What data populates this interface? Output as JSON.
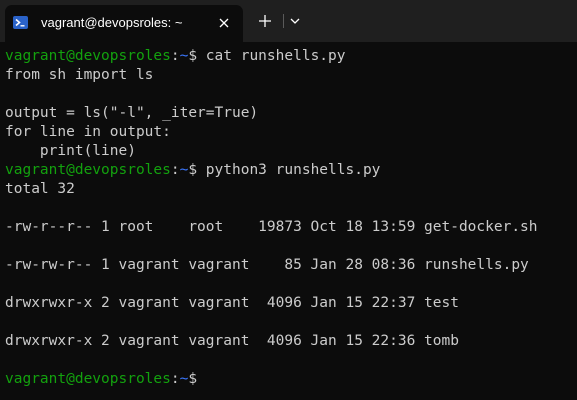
{
  "tab": {
    "title": "vagrant@devopsroles: ~",
    "icon": "terminal-icon"
  },
  "tabbar": {
    "new_tab_icon": "plus-icon",
    "dropdown_icon": "chevron-down-icon",
    "close_icon": "close-icon"
  },
  "colors": {
    "prompt_user": "#13a10e",
    "prompt_path": "#3b78ff",
    "text": "#cccccc",
    "background": "#0c0c0c",
    "tabbar": "#1f1f1f"
  },
  "prompt": {
    "user_host": "vagrant@devopsroles",
    "colon": ":",
    "path": "~",
    "symbol": "$"
  },
  "terminal": {
    "cmd1": " cat runshells.py",
    "file_lines": [
      "from sh import ls",
      "",
      "output = ls(\"-l\", _iter=True)",
      "for line in output:",
      "    print(line)"
    ],
    "cmd2": " python3 runshells.py",
    "output_lines": [
      "total 32",
      "",
      "-rw-r--r-- 1 root    root    19873 Oct 18 13:59 get-docker.sh",
      "",
      "-rw-rw-r-- 1 vagrant vagrant    85 Jan 28 08:36 runshells.py",
      "",
      "drwxrwxr-x 2 vagrant vagrant  4096 Jan 15 22:37 test",
      "",
      "drwxrwxr-x 2 vagrant vagrant  4096 Jan 15 22:36 tomb",
      ""
    ],
    "cmd3": ""
  }
}
